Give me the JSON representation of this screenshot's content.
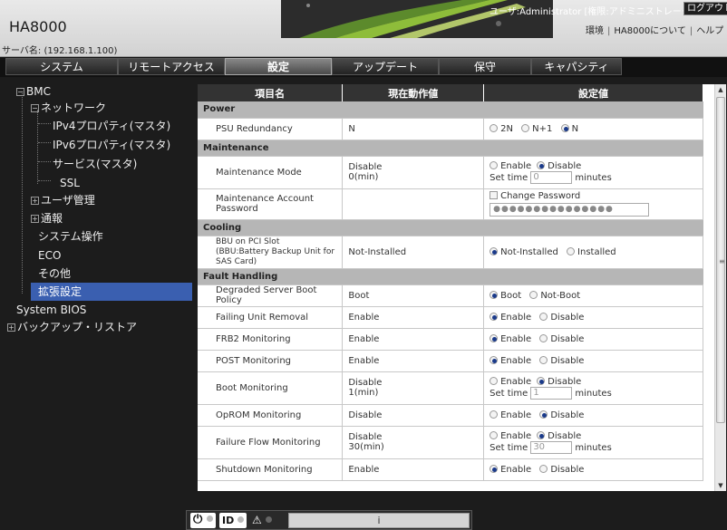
{
  "header": {
    "title": "HA8000",
    "server_name": "サーバ名: (192.168.1.100)",
    "user_info": "ユーザ:Administrator [権限:アドミニストレータ]",
    "logout_label": "ログアウト",
    "links": [
      "環境",
      "HA8000について",
      "ヘルプ"
    ]
  },
  "nav": {
    "tabs": [
      {
        "label": "システム",
        "active": false
      },
      {
        "label": "リモートアクセス",
        "active": false
      },
      {
        "label": "設定",
        "active": true
      },
      {
        "label": "アップデート",
        "active": false
      },
      {
        "label": "保守",
        "active": false
      },
      {
        "label": "キャパシティ",
        "active": false
      }
    ]
  },
  "sidebar": {
    "items": [
      {
        "label": "BMC",
        "toggle": "⊟"
      },
      {
        "label": "ネットワーク",
        "toggle": "⊟"
      },
      {
        "label": "IPv4プロパティ(マスタ)"
      },
      {
        "label": "IPv6プロパティ(マスタ)"
      },
      {
        "label": "サービス(マスタ)"
      },
      {
        "label": "SSL"
      },
      {
        "label": "ユーザ管理",
        "toggle": "⊞"
      },
      {
        "label": "通報",
        "toggle": "⊞"
      },
      {
        "label": "システム操作"
      },
      {
        "label": "ECO"
      },
      {
        "label": "その他"
      },
      {
        "label": "拡張設定",
        "selected": true
      },
      {
        "label": "System BIOS"
      },
      {
        "label": "バックアップ・リストア",
        "toggle": "⊞"
      }
    ]
  },
  "table": {
    "headers": [
      "項目名",
      "現在動作値",
      "設定値"
    ],
    "sections": {
      "power": "Power",
      "maintenance": "Maintenance",
      "cooling": "Cooling",
      "fault": "Fault Handling"
    },
    "rows": {
      "psu": {
        "name": "PSU Redundancy",
        "value": "N",
        "options": [
          "2N",
          "N+1",
          "N"
        ],
        "selected": "N"
      },
      "maint_mode": {
        "name": "Maintenance Mode",
        "value_line1": "Disable",
        "value_line2": "0(min)",
        "options": [
          "Enable",
          "Disable"
        ],
        "selected": "Disable",
        "set_time_label": "Set time",
        "set_time_value": "0",
        "minutes_label": "minutes"
      },
      "maint_pw": {
        "name_line1": "Maintenance Account",
        "name_line2": "Password",
        "value": "",
        "checkbox_label": "Change Password",
        "password_mask": "●●●●●●●●●●●●●●●"
      },
      "bbu": {
        "name_line1": "BBU on PCI Slot",
        "name_line2": "(BBU:Battery Backup Unit for",
        "name_line3": "SAS Card)",
        "value": "Not-Installed",
        "options": [
          "Not-Installed",
          "Installed"
        ],
        "selected": "Not-Installed"
      },
      "degraded": {
        "name": "Degraded Server Boot Policy",
        "value": "Boot",
        "options": [
          "Boot",
          "Not-Boot"
        ],
        "selected": "Boot"
      },
      "failing_unit": {
        "name": "Failing Unit Removal",
        "value": "Enable",
        "options": [
          "Enable",
          "Disable"
        ],
        "selected": "Enable"
      },
      "frb2": {
        "name": "FRB2 Monitoring",
        "value": "Enable",
        "options": [
          "Enable",
          "Disable"
        ],
        "selected": "Enable"
      },
      "post": {
        "name": "POST Monitoring",
        "value": "Enable",
        "options": [
          "Enable",
          "Disable"
        ],
        "selected": "Enable"
      },
      "boot": {
        "name": "Boot Monitoring",
        "value_line1": "Disable",
        "value_line2": "1(min)",
        "options": [
          "Enable",
          "Disable"
        ],
        "selected": "Disable",
        "set_time_label": "Set time",
        "set_time_value": "1",
        "minutes_label": "minutes"
      },
      "oprom": {
        "name": "OpROM Monitoring",
        "value": "Disable",
        "options": [
          "Enable",
          "Disable"
        ],
        "selected": "Disable"
      },
      "failure_flow": {
        "name": "Failure Flow Monitoring",
        "value_line1": "Disable",
        "value_line2": "30(min)",
        "options": [
          "Enable",
          "Disable"
        ],
        "selected": "Disable",
        "set_time_label": "Set time",
        "set_time_value": "30",
        "minutes_label": "minutes"
      },
      "shutdown": {
        "name": "Shutdown Monitoring",
        "value": "Enable",
        "options": [
          "Enable",
          "Disable"
        ],
        "selected": "Enable"
      }
    }
  },
  "bottom": {
    "power_glyph": "⏻",
    "id_label": "ID",
    "alert_glyph": "⚠",
    "status_text": "i"
  }
}
